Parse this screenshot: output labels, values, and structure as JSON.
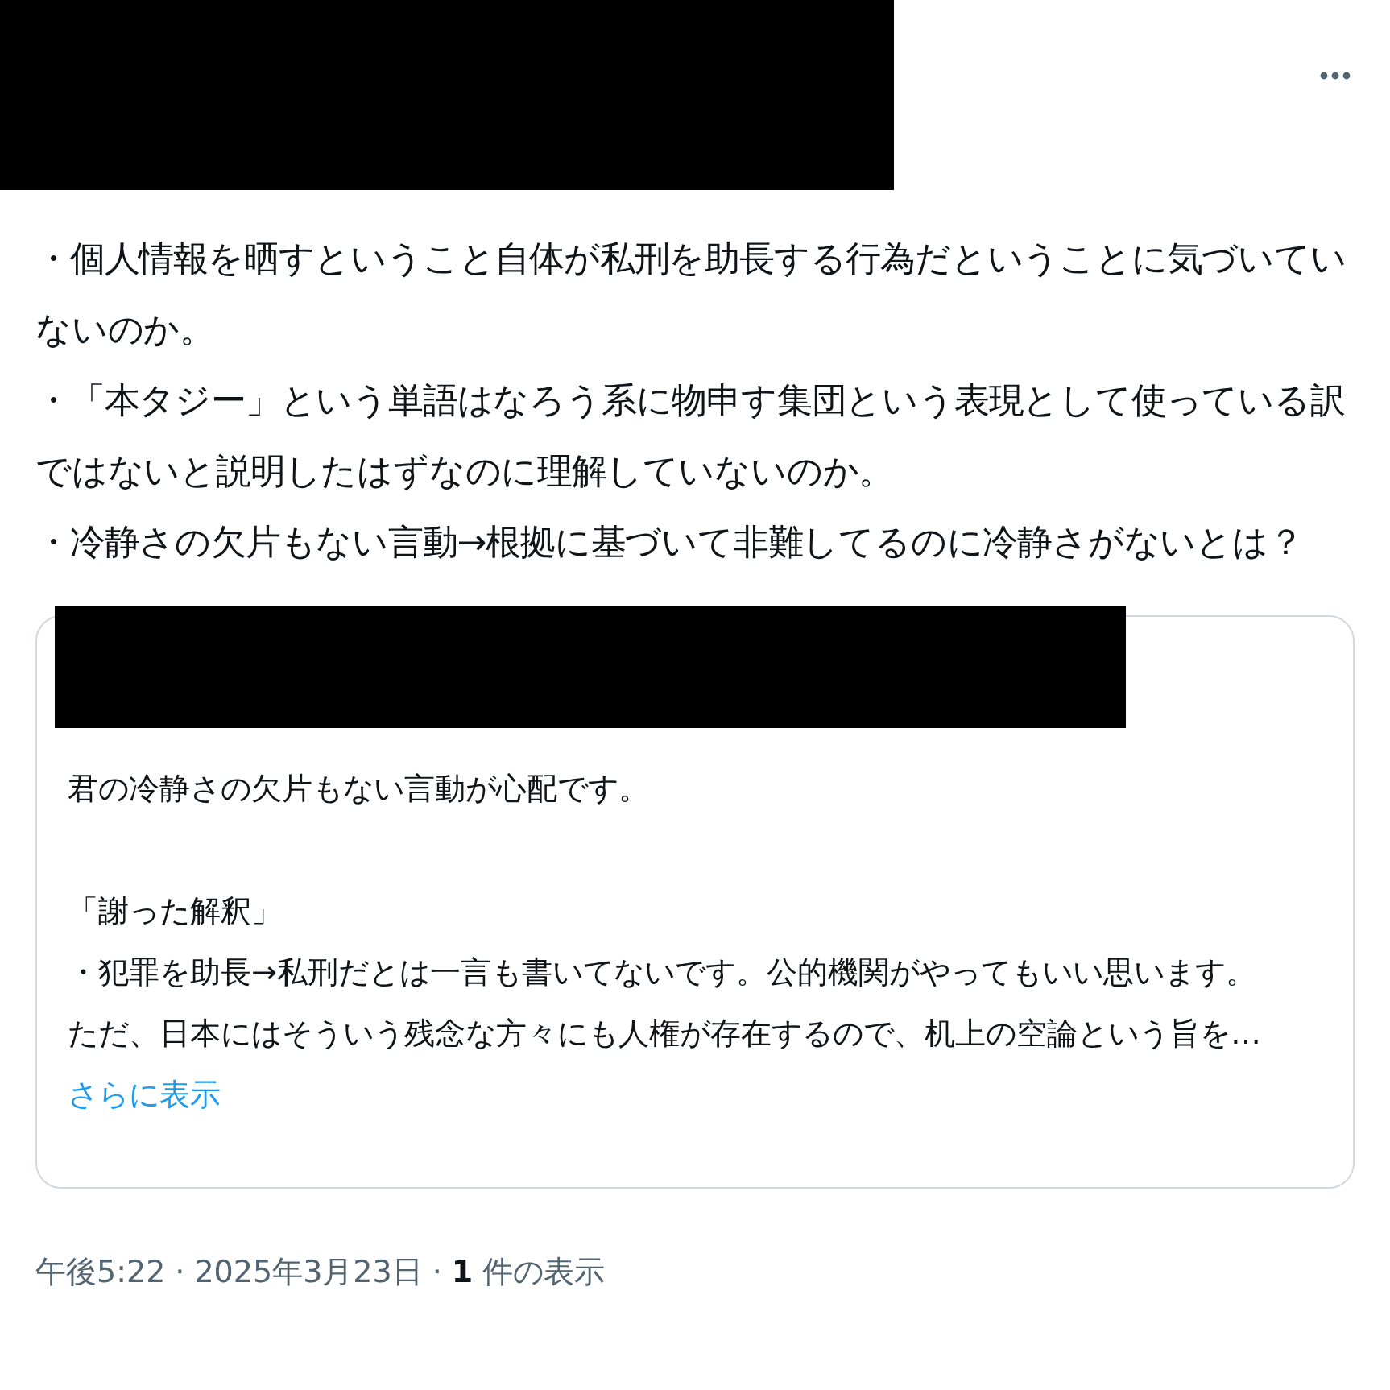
{
  "post": {
    "lines": [
      "・個人情報を晒すということ自体が私刑を助長する行為だということに気づいていないのか。",
      "・「本タジー」という単語はなろう系に物申す集団という表現として使っている訳ではないと説明したはずなのに理解していないのか。",
      "・冷静さの欠片もない言動→根拠に基づいて非難してるのに冷静さがないとは？"
    ]
  },
  "quoted_post": {
    "paragraphs": [
      [
        "君の冷静さの欠片もない言動が心配です。"
      ],
      [
        "「謝った解釈」",
        "・犯罪を助長→私刑だとは一言も書いてないです。公的機関がやってもいい思います。",
        "ただ、日本にはそういう残念な方々にも人権が存在するので、机上の空論という旨を…"
      ]
    ],
    "show_more": "さらに表示"
  },
  "footer": {
    "time": "午後5:22",
    "separator": "·",
    "date": "2025年3月23日",
    "views_count": "1",
    "views_label": "件の表示"
  }
}
